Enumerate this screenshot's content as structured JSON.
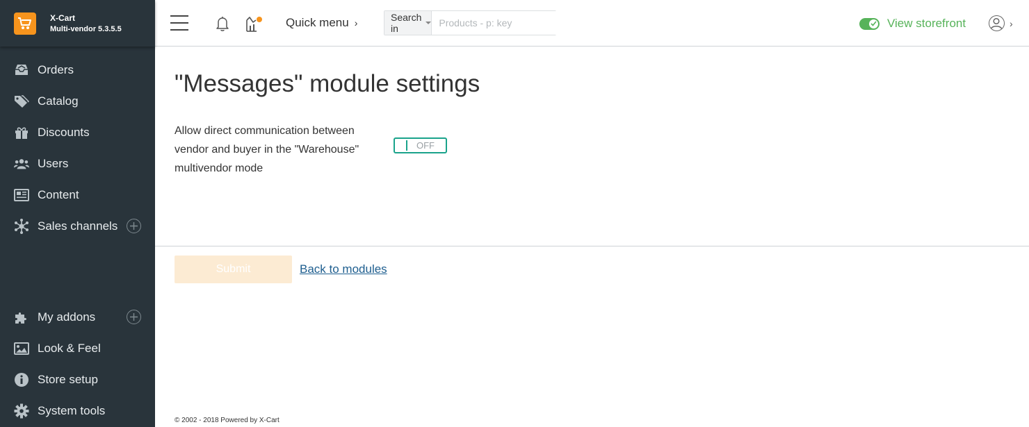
{
  "brand": {
    "name": "X-Cart",
    "version": "Multi-vendor 5.3.5.5"
  },
  "sidebar": {
    "items": [
      {
        "label": "Orders",
        "icon": "inbox-icon"
      },
      {
        "label": "Catalog",
        "icon": "tags-icon"
      },
      {
        "label": "Discounts",
        "icon": "gift-icon"
      },
      {
        "label": "Users",
        "icon": "users-icon"
      },
      {
        "label": "Content",
        "icon": "newspaper-icon"
      },
      {
        "label": "Sales channels",
        "icon": "network-icon",
        "expandable": true
      }
    ],
    "bottom_items": [
      {
        "label": "My addons",
        "icon": "puzzle-icon",
        "expandable": true
      },
      {
        "label": "Look & Feel",
        "icon": "image-icon"
      },
      {
        "label": "Store setup",
        "icon": "info-icon"
      },
      {
        "label": "System tools",
        "icon": "gear-icon"
      }
    ]
  },
  "header": {
    "quick_menu_label": "Quick menu",
    "search": {
      "scope_label": "Search in",
      "placeholder": "Products - p: key",
      "value": ""
    },
    "storefront_label": "View storefront",
    "storefront_on": true
  },
  "main": {
    "title": "\"Messages\" module settings",
    "setting": {
      "label": "Allow direct communication between vendor and buyer in the \"Warehouse\" multivendor mode",
      "toggle_state": "OFF"
    },
    "submit_label": "Submit",
    "back_link_label": "Back to modules"
  },
  "footer": {
    "text": "© 2002 - 2018 Powered by X-Cart"
  },
  "colors": {
    "sidebar_bg": "#29343b",
    "brand_orange": "#f7941d",
    "accent_green": "#57b35a",
    "toggle_teal": "#1aa38b",
    "link_blue": "#1e5e8f",
    "submit_disabled": "#fcebd3"
  }
}
